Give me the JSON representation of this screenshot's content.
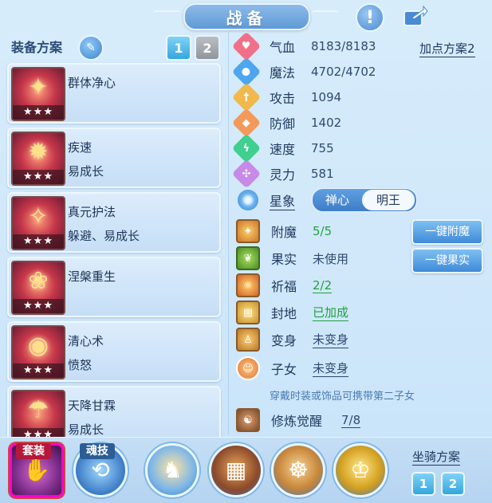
{
  "header": {
    "title": "战备",
    "info_icon": "exclamation-icon",
    "share_icon": "share-icon"
  },
  "equip_plan": {
    "title": "装备方案",
    "tabs": [
      "1",
      "2"
    ],
    "active_tab": "1",
    "items": [
      {
        "name": "群体净心",
        "sub": "",
        "stars": "★★★",
        "icon": "crimson-seal-icon"
      },
      {
        "name": "疾速",
        "sub": "易成长",
        "stars": "★★★",
        "icon": "golden-beast-icon"
      },
      {
        "name": "真元护法",
        "sub": "躲避、易成长",
        "stars": "★★★",
        "icon": "guardian-icon"
      },
      {
        "name": "涅槃重生",
        "sub": "",
        "stars": "★★★",
        "icon": "phoenix-icon"
      },
      {
        "name": "清心术",
        "sub": "愤怒",
        "stars": "★★★",
        "icon": "flame-ring-icon"
      },
      {
        "name": "天降甘霖",
        "sub": "易成长",
        "stars": "★★★",
        "icon": "rain-god-icon"
      }
    ]
  },
  "attributes": {
    "plan_link": "加点方案2",
    "rows": [
      {
        "label": "气血",
        "value": "8183/8183",
        "icon": "heart-icon",
        "color": "#f0708a"
      },
      {
        "label": "魔法",
        "value": "4702/4702",
        "icon": "mana-icon",
        "color": "#4da6ef"
      },
      {
        "label": "攻击",
        "value": "1094",
        "icon": "sword-icon",
        "color": "#f2b84a"
      },
      {
        "label": "防御",
        "value": "1402",
        "icon": "shield-icon",
        "color": "#f39a5a"
      },
      {
        "label": "速度",
        "value": "755",
        "icon": "lightning-icon",
        "color": "#3fcf8e"
      },
      {
        "label": "灵力",
        "value": "581",
        "icon": "spirit-icon",
        "color": "#c78ae8"
      }
    ]
  },
  "star_sign": {
    "label": "星象",
    "options": [
      "禅心",
      "明王"
    ],
    "selected": "明王"
  },
  "status": {
    "rows": [
      {
        "label": "附魔",
        "value": "5/5",
        "style": "green"
      },
      {
        "label": "果实",
        "value": "未使用",
        "style": "dark"
      },
      {
        "label": "祈福",
        "value": "2/2",
        "style": "green-underline"
      },
      {
        "label": "封地",
        "value": "已加成",
        "style": "green-underline"
      },
      {
        "label": "变身",
        "value": "未变身",
        "style": "dark-underline"
      },
      {
        "label": "子女",
        "value": "未变身",
        "style": "dark-underline"
      }
    ],
    "hint": "穿戴时装或饰品可携带第二子女",
    "cultivation": {
      "label": "修炼觉醒",
      "value": "7/8"
    },
    "buttons": {
      "enchant": "一键附魔",
      "fruit": "一键果实"
    }
  },
  "bottom": {
    "suit_label": "套装",
    "skill_label": "魂技",
    "mount_title": "坐骑方案",
    "mount_tabs": [
      "1",
      "2"
    ]
  }
}
